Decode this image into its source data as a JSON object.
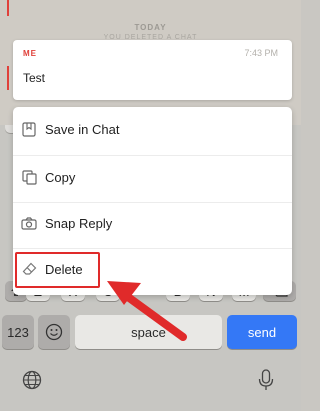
{
  "chat": {
    "day_label": "TODAY",
    "info_line": "YOU DELETED A CHAT",
    "message": {
      "sender": "ME",
      "time": "7:43 PM",
      "text": "Test"
    }
  },
  "menu": {
    "items": [
      {
        "label": "Save in Chat",
        "icon": "bookmark-icon"
      },
      {
        "label": "Copy",
        "icon": "copy-icon"
      },
      {
        "label": "Snap Reply",
        "icon": "camera-icon"
      },
      {
        "label": "Delete",
        "icon": "eraser-icon"
      }
    ],
    "highlight_color": "#e02a2a"
  },
  "keyboard": {
    "partial_keys": [
      "Z",
      "X",
      "C",
      "V",
      "B",
      "N",
      "M"
    ],
    "numbers_label": "123",
    "space_label": "space",
    "send_label": "send",
    "send_color": "#3478f6"
  },
  "annotation": {
    "arrow_color": "#e02a2a"
  }
}
